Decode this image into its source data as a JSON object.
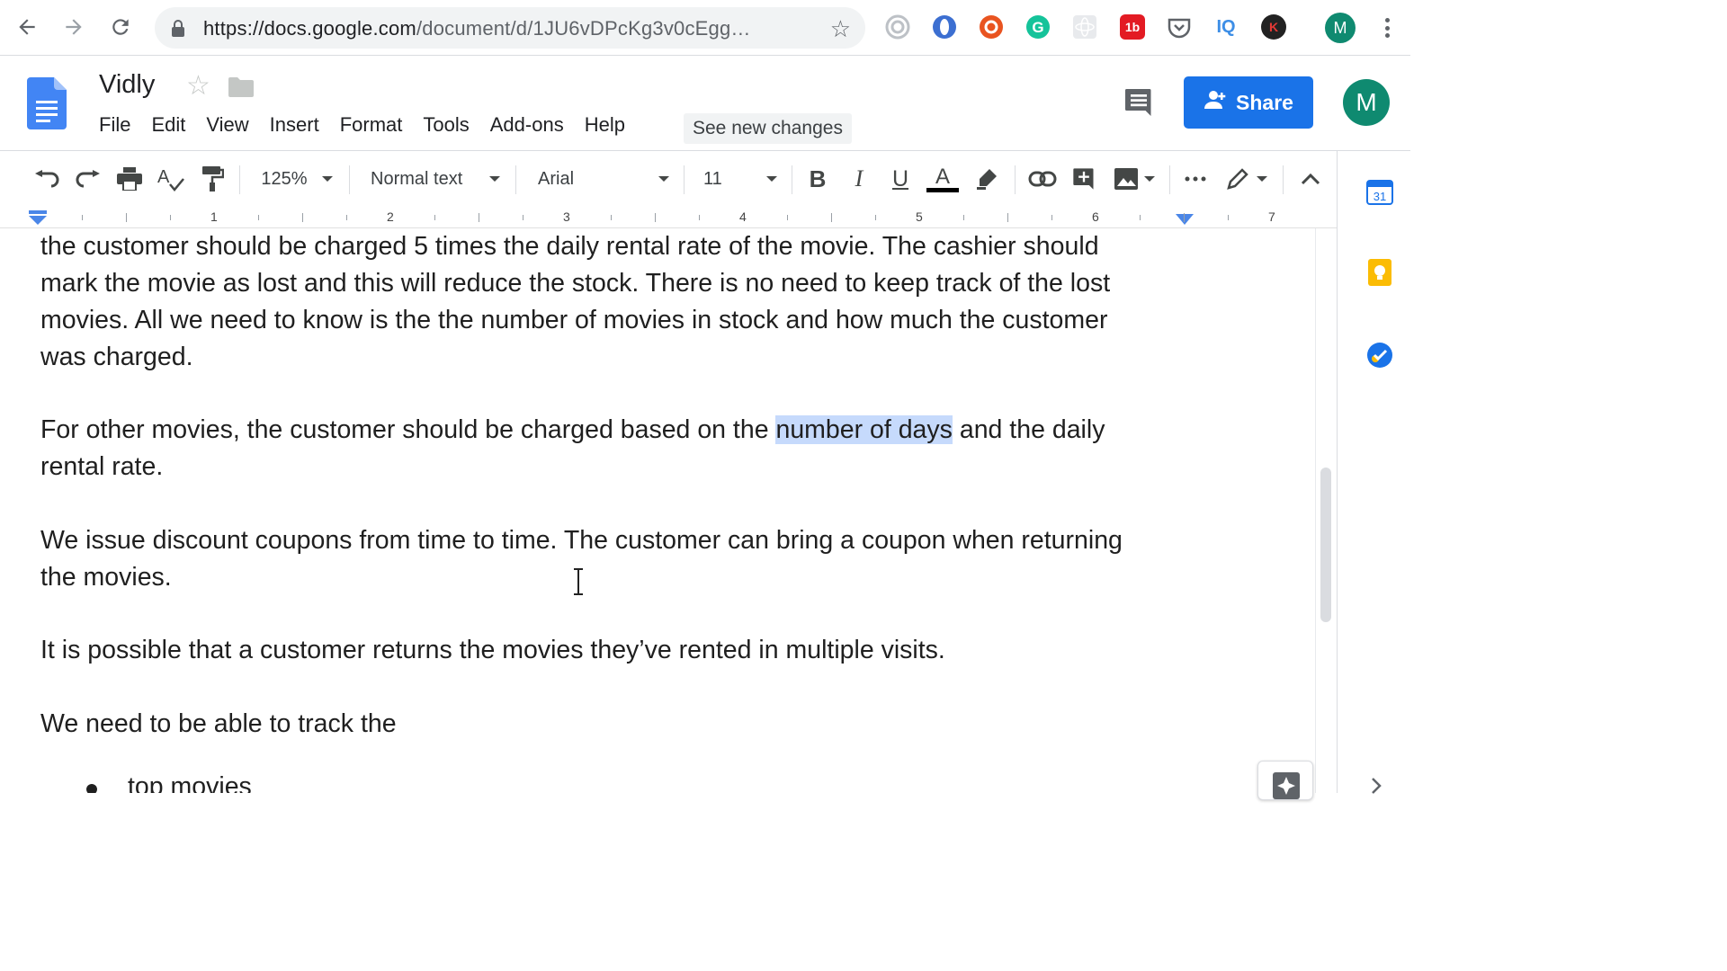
{
  "browser": {
    "url_host": "https://docs.google.com",
    "url_path": "/document/d/1JU6vDPcKg3v0cEgg…",
    "extensions": [
      "lighthouse-icon",
      "blue-circle-icon",
      "ubuntu-icon",
      "grammarly-icon",
      "react-icon",
      "1b-icon",
      "pocket-icon",
      "iq-icon",
      "k-icon"
    ],
    "ext_1b": "1b",
    "ext_iq": "IQ",
    "ext_k": "K",
    "avatar": "M"
  },
  "docs": {
    "title": "Vidly",
    "menu": [
      "File",
      "Edit",
      "View",
      "Insert",
      "Format",
      "Tools",
      "Add-ons",
      "Help"
    ],
    "see_new_changes": "See new changes",
    "share_label": "Share",
    "avatar": "M"
  },
  "toolbar": {
    "zoom": "125%",
    "style": "Normal text",
    "font": "Arial",
    "size": "11",
    "bold": "B",
    "italic": "I",
    "underline": "U",
    "text_color": "A"
  },
  "ruler": {
    "numbers": [
      "1",
      "2",
      "3",
      "4",
      "5",
      "6",
      "7"
    ]
  },
  "document": {
    "p1_lines": [
      "the customer should be charged 5 times the daily rental rate of the movie. The cashier should",
      "mark the movie as lost and this will reduce the stock. There is no need to keep track of the lost",
      "movies. All we need to know is the the number of movies in stock and how much the customer",
      "was charged."
    ],
    "p2_before": "For other movies, the customer should be charged based on the ",
    "p2_highlight": "number of days",
    "p2_after": " and the daily",
    "p2_line2": "rental rate.",
    "p3_line1": "We issue discount coupons from time to time. The customer can bring a coupon when returning",
    "p3_line2": "the movies.",
    "p4": "It is possible that a customer returns the movies they’ve rented in multiple visits.",
    "p5": "We need to be able to track the",
    "bullet1": "top movies"
  },
  "side_panel": {
    "calendar_day": "31"
  },
  "colors": {
    "accent": "#1a73e8",
    "highlight": "#c6dafc",
    "avatar": "#0f8a70"
  }
}
